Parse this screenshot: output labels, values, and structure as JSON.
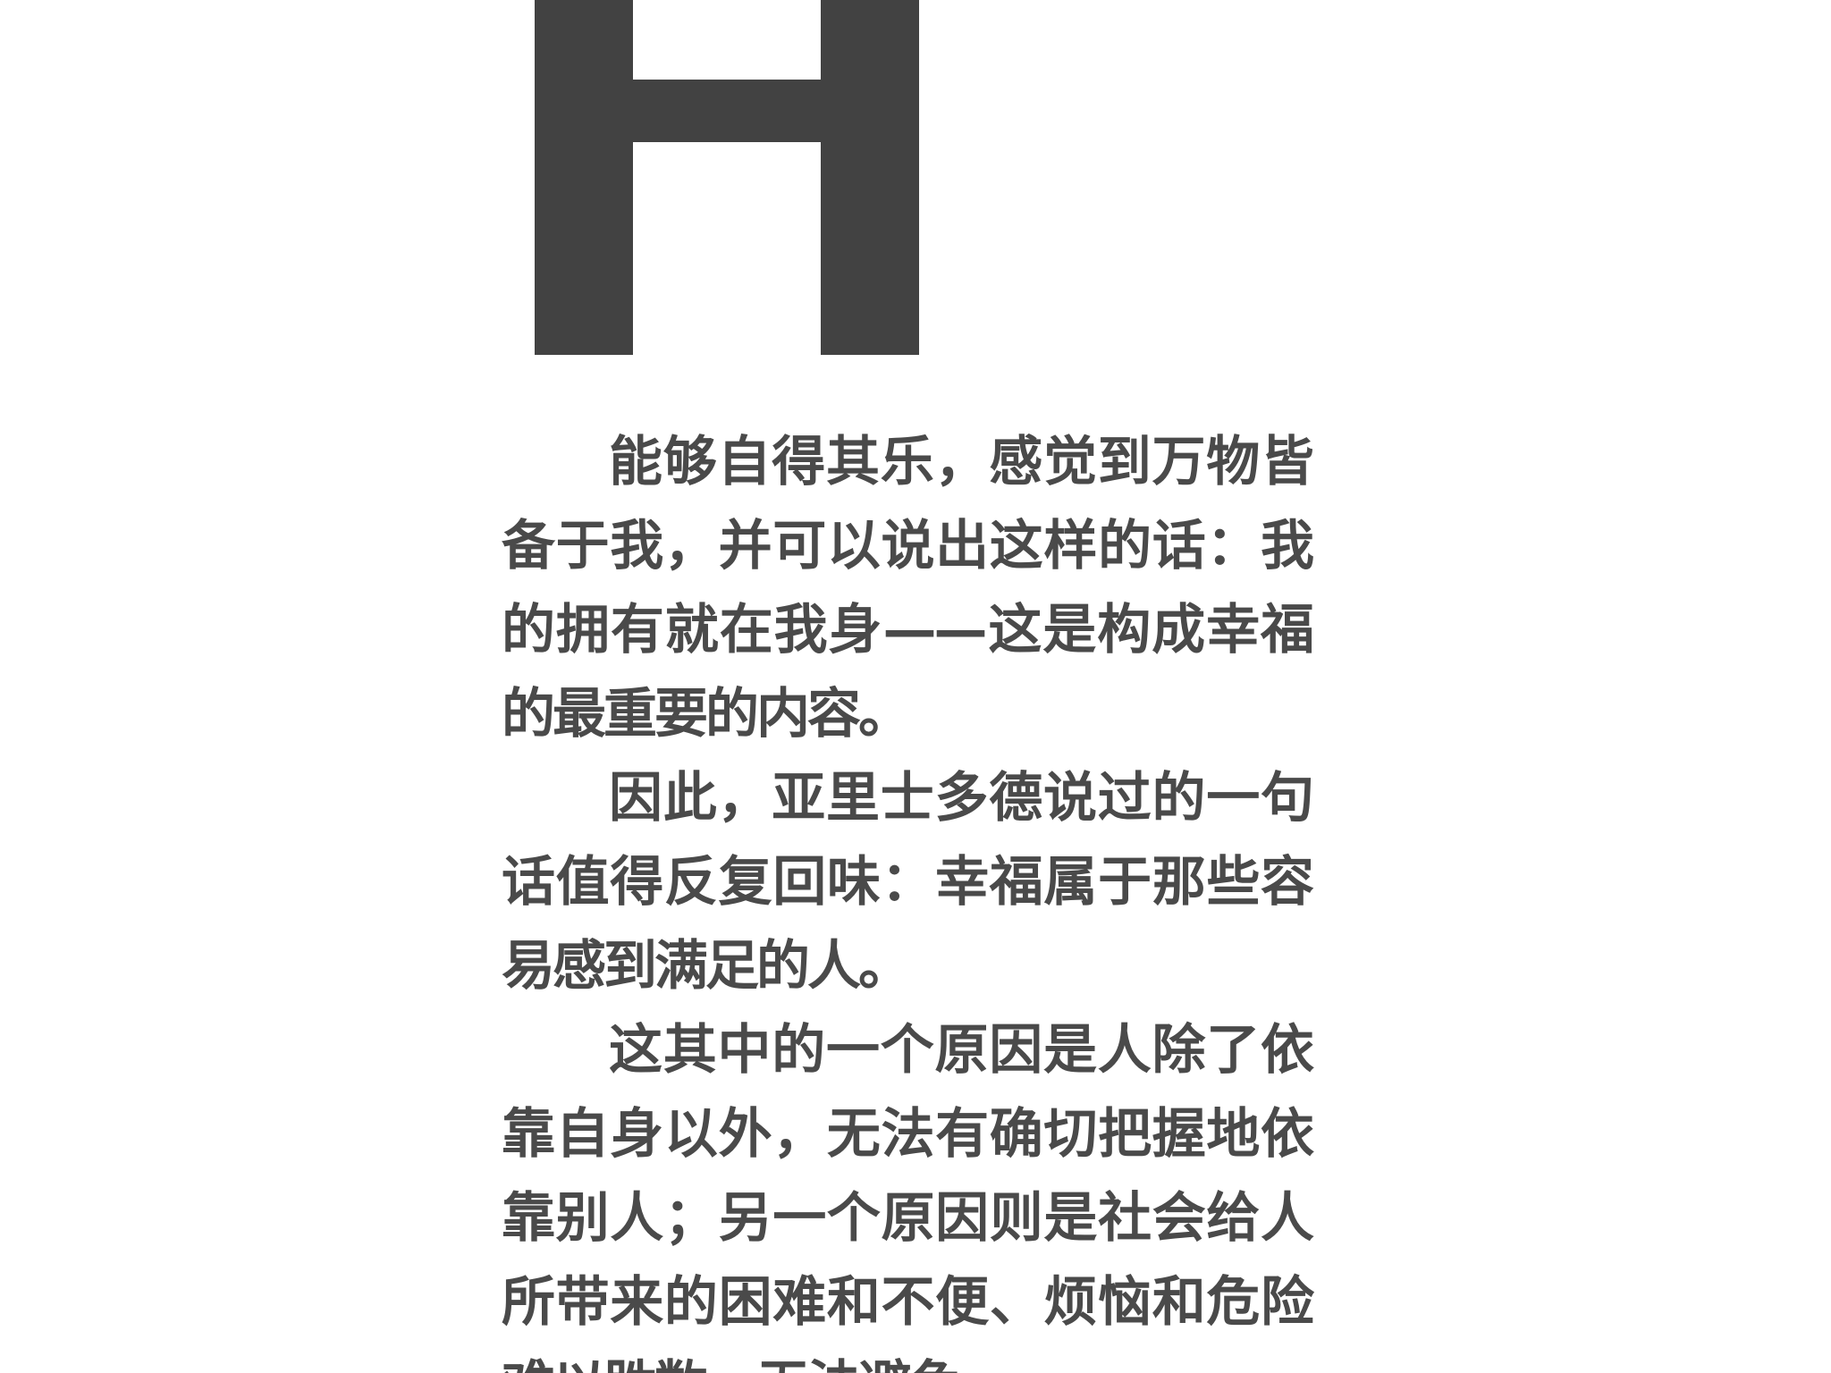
{
  "drop_cap": {
    "letter": "H",
    "color": "#424242"
  },
  "text_color": "#4a4a4a",
  "paragraphs": [
    "能够自得其乐，感觉到万物皆备于我，并可以说出这样的话：我的拥有就在我身——这是构成幸福的最重要的内容。",
    "因此，亚里士多德说过的一句话值得反复回味：幸福属于那些容易感到满足的人。",
    "这其中的一个原因是人除了依靠自身以外，无法有确切把握地依靠别人；另一个原因则是社会给人所带来的困难和不便、烦恼和危险难以胜数，无法避免。"
  ]
}
